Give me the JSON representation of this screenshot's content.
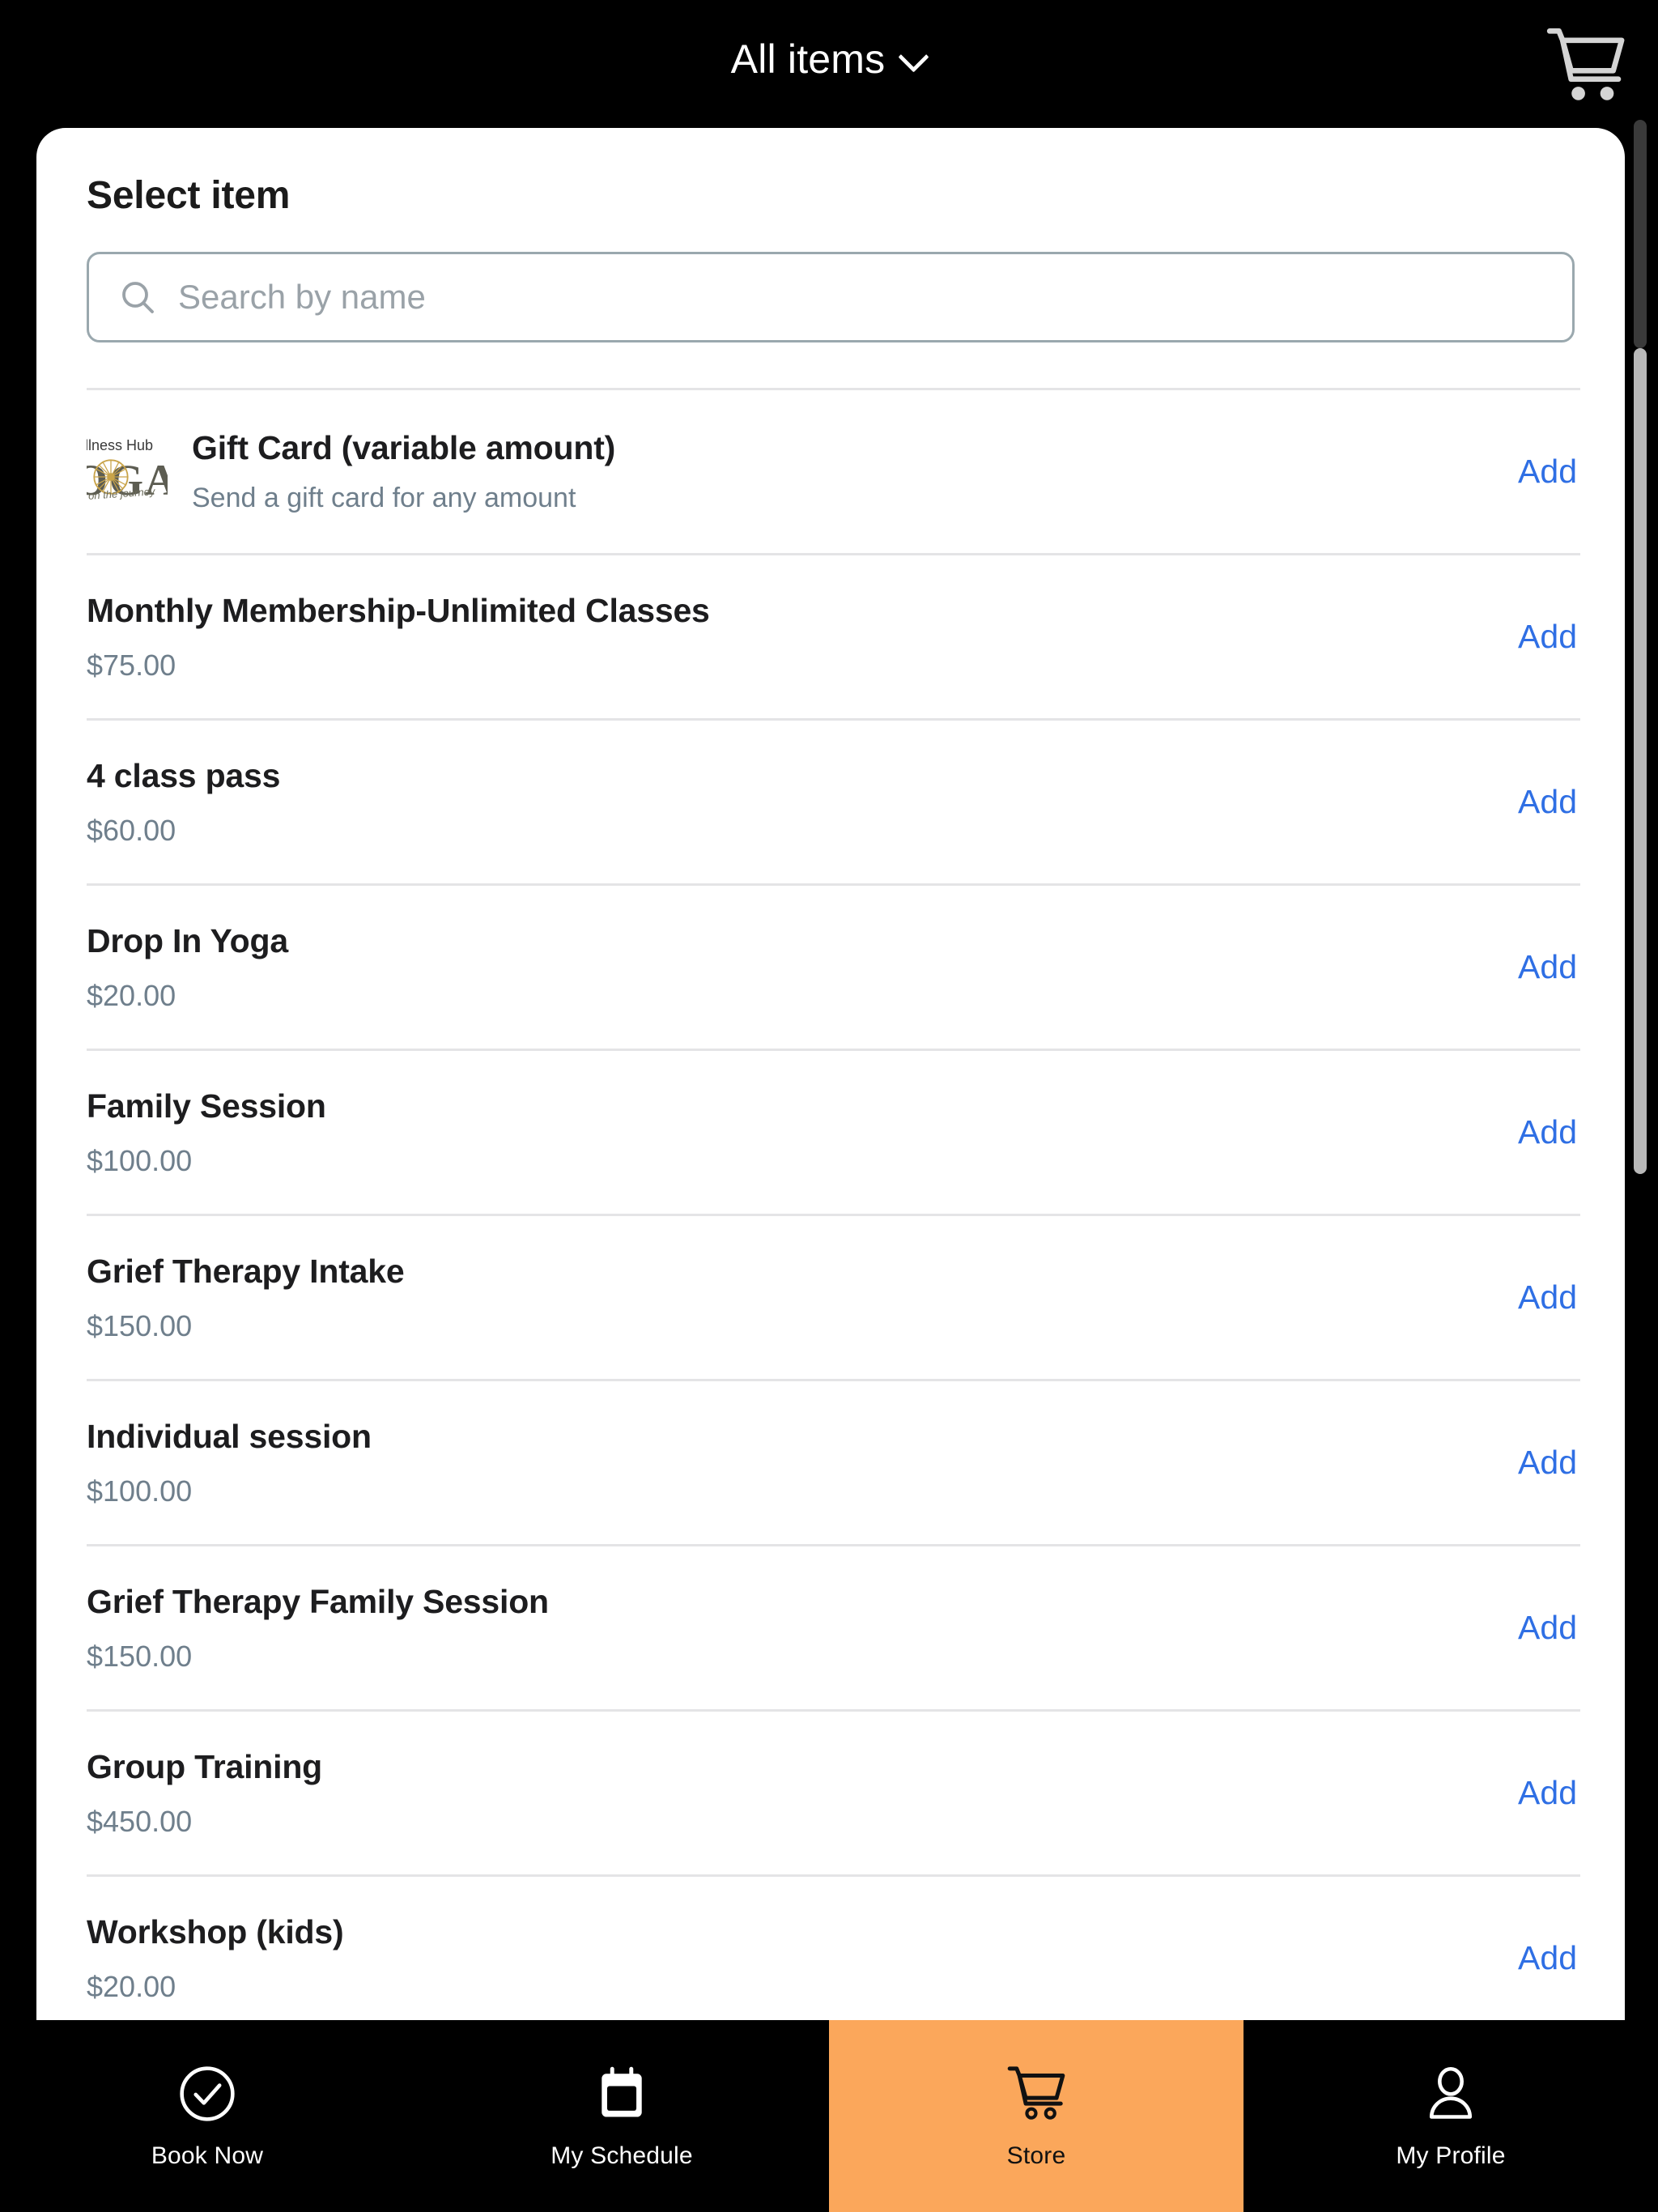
{
  "topbar": {
    "title": "All items",
    "chevron_icon": "chevron-down-icon",
    "cart_icon": "shopping-cart-icon"
  },
  "sheet": {
    "title": "Select item",
    "search": {
      "placeholder": "Search by name",
      "value": "",
      "icon": "search-icon"
    }
  },
  "logo": {
    "top_text": "llness Hub",
    "big_text": "OGA",
    "arc_text": "on the journey"
  },
  "items": [
    {
      "name": "Gift Card (variable amount)",
      "subtitle": "Send a gift card for any amount",
      "price": "",
      "add_label": "Add",
      "has_thumb": true
    },
    {
      "name": "Monthly Membership-Unlimited Classes",
      "subtitle": "",
      "price": "$75.00",
      "add_label": "Add",
      "has_thumb": false
    },
    {
      "name": "4 class pass",
      "subtitle": "",
      "price": "$60.00",
      "add_label": "Add",
      "has_thumb": false
    },
    {
      "name": "Drop In Yoga",
      "subtitle": "",
      "price": "$20.00",
      "add_label": "Add",
      "has_thumb": false
    },
    {
      "name": "Family Session",
      "subtitle": "",
      "price": "$100.00",
      "add_label": "Add",
      "has_thumb": false
    },
    {
      "name": "Grief Therapy Intake",
      "subtitle": "",
      "price": "$150.00",
      "add_label": "Add",
      "has_thumb": false
    },
    {
      "name": "Individual session",
      "subtitle": "",
      "price": "$100.00",
      "add_label": "Add",
      "has_thumb": false
    },
    {
      "name": "Grief Therapy Family Session",
      "subtitle": "",
      "price": "$150.00",
      "add_label": "Add",
      "has_thumb": false
    },
    {
      "name": "Group Training",
      "subtitle": "",
      "price": "$450.00",
      "add_label": "Add",
      "has_thumb": false
    },
    {
      "name": "Workshop (kids)",
      "subtitle": "",
      "price": "$20.00",
      "add_label": "Add",
      "has_thumb": false
    }
  ],
  "bottom_nav": {
    "active_color": "#fba75b",
    "items": [
      {
        "label": "Book Now",
        "icon": "check-circle-icon",
        "active": false
      },
      {
        "label": "My Schedule",
        "icon": "calendar-icon",
        "active": false
      },
      {
        "label": "Store",
        "icon": "shopping-cart-icon",
        "active": true
      },
      {
        "label": "My Profile",
        "icon": "user-icon",
        "active": false
      }
    ]
  },
  "colors": {
    "accent_blue": "#2f6fe4",
    "accent_orange": "#fba75b",
    "price_gray": "#6f7f8c",
    "divider": "#e4e4e6"
  }
}
